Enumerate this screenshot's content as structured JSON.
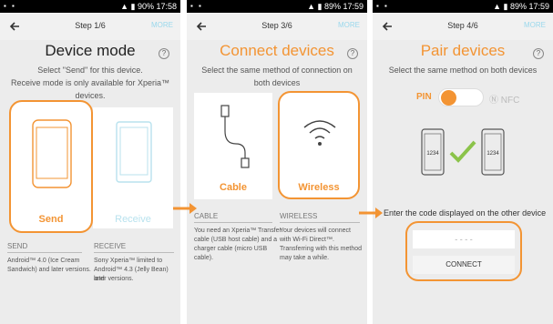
{
  "status_bars": [
    {
      "battery": "90%",
      "time": "17:58"
    },
    {
      "battery": "89%",
      "time": "17:59"
    },
    {
      "battery": "89%",
      "time": "17:59"
    }
  ],
  "more_label": "MORE",
  "panel1": {
    "step": "Step 1/6",
    "title": "Device mode",
    "subtitle_1": "Select \"Send\" for this device.",
    "subtitle_2": "Receive mode is only available for Xperia™",
    "subtitle_3": "devices.",
    "send_label": "Send",
    "receive_label": "Receive",
    "send_header": "SEND",
    "send_text_1": "Android™ 4.0 (Ice Cream",
    "send_text_2": "Sandwich) and later versions.",
    "receive_header": "RECEIVE",
    "receive_text_1": "Sony Xperia™ limited to",
    "receive_text_2": "Android™ 4.3 (Jelly Bean) and",
    "receive_text_3": "later versions."
  },
  "panel2": {
    "step": "Step 3/6",
    "title": "Connect devices",
    "subtitle_1": "Select the same method of connection on",
    "subtitle_2": "both devices",
    "cable_label": "Cable",
    "wireless_label": "Wireless",
    "cable_header": "CABLE",
    "cable_text_1": "You need an Xperia™ Transfer",
    "cable_text_2": "cable (USB host cable) and a",
    "cable_text_3": "charger cable (micro USB",
    "cable_text_4": "cable).",
    "wireless_header": "WIRELESS",
    "wireless_text_1": "Your devices will connect",
    "wireless_text_2": "with Wi-Fi Direct™.",
    "wireless_text_3": "Transferring with this method",
    "wireless_text_4": "may take a while."
  },
  "panel3": {
    "step": "Step 4/6",
    "title": "Pair devices",
    "subtitle": "Select the same method on both devices",
    "pin_label": "PIN",
    "nfc_label": "NFC",
    "phone_code": "1234",
    "enter_code": "Enter the code displayed on the other device",
    "code_placeholder": "- - - -",
    "connect_label": "CONNECT"
  },
  "colors": {
    "accent": "#f39433",
    "faded": "#9ad8ec",
    "panel_bg": "#ececec"
  }
}
